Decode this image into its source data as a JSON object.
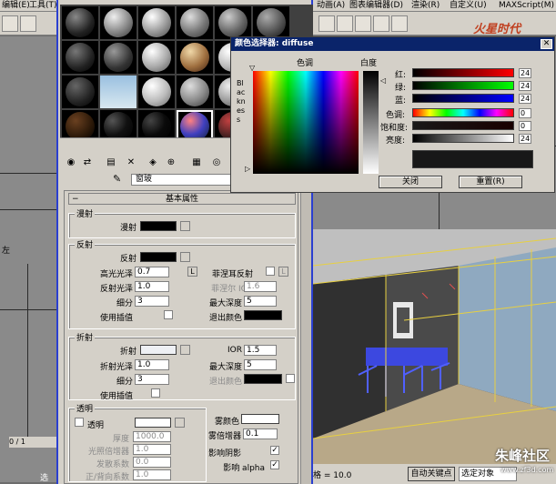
{
  "menubar": {
    "left_items": [
      "编辑(E)",
      "工具(T)"
    ],
    "right_items": [
      "动画(A)",
      "图表编辑器(D)",
      "渲染(R)",
      "自定义(U)",
      "MAXScript(M)"
    ]
  },
  "watermark_top": "火星时代",
  "watermark_bottom": "朱峰社区",
  "watermark_url": "www.zf3d.com",
  "material_toolbar": {
    "material_name": "窗玻"
  },
  "rollout": {
    "title": "基本属性"
  },
  "diffuse": {
    "group": "漫射",
    "label": "漫射",
    "color": "#000000"
  },
  "reflection": {
    "group": "反射",
    "label": "反射",
    "color": "#000000",
    "gloss_label": "高光光泽",
    "gloss_value": "0.7",
    "l_label": "L",
    "refl_gloss_label": "反射光泽",
    "refl_gloss_value": "1.0",
    "subdiv_label": "细分",
    "subdiv_value": "3",
    "interp_label": "使用插值",
    "fresnel_label": "菲涅耳反射",
    "fresnel_l": "L",
    "fresnel_ior_label": "菲涅尔 IOR",
    "fresnel_ior_value": "1.6",
    "max_depth_label": "最大深度",
    "max_depth_value": "5",
    "exit_color_label": "退出颜色",
    "exit_color": "#000000"
  },
  "refraction": {
    "group": "折射",
    "label": "折射",
    "color": "#eef0f4",
    "gloss_label": "折射光泽",
    "gloss_value": "1.0",
    "subdiv_label": "细分",
    "subdiv_value": "3",
    "interp_label": "使用插值",
    "ior_label": "IOR",
    "ior_value": "1.5",
    "max_depth_label": "最大深度",
    "max_depth_value": "5",
    "exit_color_label": "退出颜色",
    "exit_color": "#000000"
  },
  "translucency": {
    "group": "透明",
    "check_label": "透明",
    "thickness_label": "厚度",
    "thickness_value": "1000.0",
    "light_mult_label": "光照倍增器",
    "light_mult_value": "1.0",
    "scatter_label": "发散系数",
    "scatter_value": "0.0",
    "fb_label": "正/背向系数",
    "fb_value": "1.0"
  },
  "fog": {
    "color_label": "雾颜色",
    "color": "#ffffff",
    "mult_label": "雾倍增器",
    "mult_value": "0.1",
    "shadows_label": "影响阴影",
    "alpha_label": "影响 alpha"
  },
  "dialog": {
    "title": "颜色选择器: diffuse",
    "hue_label": "色调",
    "white_label": "白度",
    "blackness_label": "Blackness",
    "red_label": "红:",
    "green_label": "绿:",
    "blue_label": "蓝:",
    "red_value": "24",
    "green_value": "24",
    "blue_value": "24",
    "hue_label2": "色调:",
    "sat_label": "饱和度:",
    "val_label": "亮度:",
    "hue_value": "0",
    "sat_value": "0",
    "val_value": "24",
    "preview_color": "#181818",
    "close_button": "关闭",
    "reset_button": "重置(R)"
  },
  "status": {
    "grid_label": "格 = 10.0",
    "autokey_button": "自动关键点",
    "selected_label": "选定对象"
  },
  "left_viewport": {
    "label": "左",
    "frame_label": "0 / 1"
  },
  "bottom_left": {
    "label": "选"
  }
}
